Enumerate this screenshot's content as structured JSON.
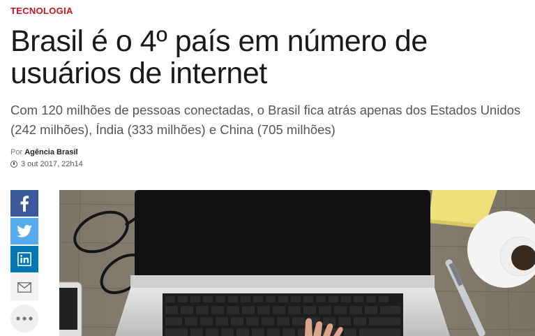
{
  "article": {
    "section": "TECNOLOGIA",
    "title": "Brasil é o 4º país em número de usuários de internet",
    "subtitle": "Com 120 milhões de pessoas conectadas, o Brasil fica atrás apenas dos Estados Unidos (242 milhões), Índia (333 milhões) e China (705 milhões)",
    "byline_prefix": "Por",
    "author": "Agência Brasil",
    "date": "3 out 2017, 22h14"
  },
  "share": {
    "icons": [
      "facebook-icon",
      "twitter-icon",
      "linkedin-icon",
      "mail-icon",
      "more-icon"
    ]
  },
  "colors": {
    "section": "#c4171d",
    "facebook": "#3b5998",
    "twitter": "#55acee",
    "linkedin": "#0077b5"
  }
}
